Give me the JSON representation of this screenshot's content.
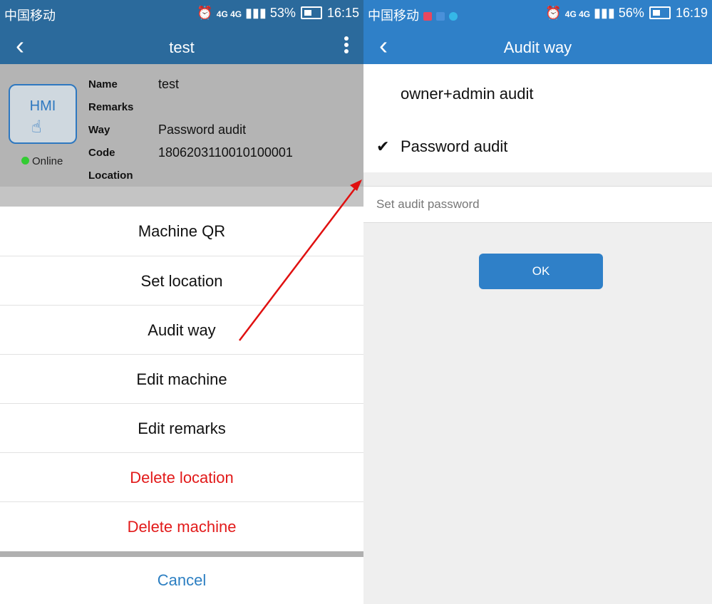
{
  "left": {
    "status": {
      "carrier": "中国移动",
      "network": "4G 4G",
      "battery": "53%",
      "time": "16:15"
    },
    "appbar": {
      "back": "‹",
      "title": "test"
    },
    "device": {
      "badge": "HMI",
      "status": "Online",
      "fields": [
        {
          "label": "Name",
          "value": "test"
        },
        {
          "label": "Remarks",
          "value": ""
        },
        {
          "label": "Way",
          "value": "Password audit"
        },
        {
          "label": "Code",
          "value": "1806203110010100001"
        },
        {
          "label": "Location",
          "value": ""
        }
      ]
    },
    "menu": [
      {
        "label": "Machine QR",
        "danger": false
      },
      {
        "label": "Set location",
        "danger": false
      },
      {
        "label": "Audit way",
        "danger": false
      },
      {
        "label": "Edit machine",
        "danger": false
      },
      {
        "label": "Edit remarks",
        "danger": false
      },
      {
        "label": "Delete location",
        "danger": true
      },
      {
        "label": "Delete machine",
        "danger": true
      }
    ],
    "cancel": "Cancel"
  },
  "right": {
    "status": {
      "carrier": "中国移动",
      "network": "4G 4G",
      "battery": "56%",
      "time": "16:19"
    },
    "appbar": {
      "back": "‹",
      "title": "Audit way"
    },
    "options": [
      {
        "label": "owner+admin audit",
        "checked": false
      },
      {
        "label": "Password audit",
        "checked": true
      }
    ],
    "check_mark": "✔",
    "password_placeholder": "Set audit password",
    "ok": "OK"
  },
  "colors": {
    "left_bar": "#2b6a9c",
    "right_bar": "#2f80c8",
    "danger": "#e21a1a",
    "cancel": "#2c7fc2",
    "arrow": "#e01010",
    "online": "#33cc33"
  }
}
